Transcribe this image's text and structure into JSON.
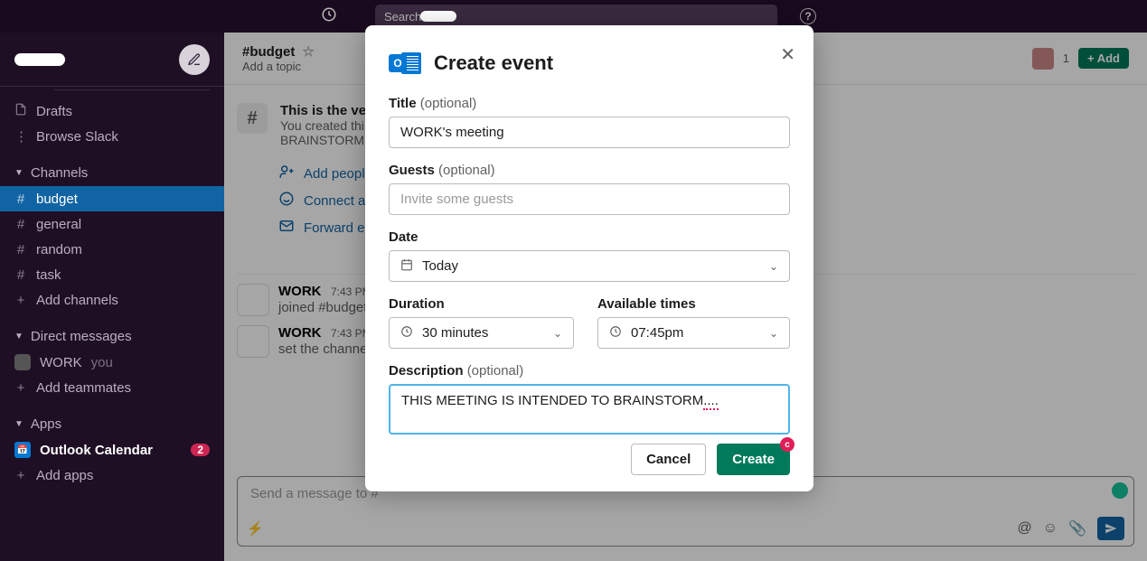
{
  "topbar": {
    "search_label": "Search",
    "help_label": "?"
  },
  "sidebar": {
    "drafts": "Drafts",
    "browse": "Browse Slack",
    "channels_header": "Channels",
    "channels": [
      {
        "name": "budget",
        "active": true
      },
      {
        "name": "general",
        "active": false
      },
      {
        "name": "random",
        "active": false
      },
      {
        "name": "task",
        "active": false
      }
    ],
    "add_channels": "Add channels",
    "dm_header": "Direct messages",
    "dm_user": "WORK",
    "dm_you": "you",
    "add_teammates": "Add teammates",
    "apps_header": "Apps",
    "app_outlook": "Outlook Calendar",
    "app_badge": "2",
    "add_apps": "Add apps"
  },
  "channel": {
    "name": "#budget",
    "topic": "Add a topic",
    "member_count": "1",
    "add_label": "+ Add",
    "intro_first": "This is the very",
    "intro_sub1": "You created thi",
    "intro_sub2": "BRAINSTORM",
    "action_add_people": "Add people",
    "action_connect": "Connect a",
    "action_forward": "Forward e",
    "msg_sender": "WORK",
    "msg_ts": "7:43 PM",
    "msg1_text": "joined #budget",
    "msg2_text": "set the channel",
    "composer_placeholder": "Send a message to #"
  },
  "modal": {
    "title": "Create event",
    "title_label": "Title",
    "title_optional": "(optional)",
    "title_value": "WORK's meeting",
    "guests_label": "Guests",
    "guests_optional": "(optional)",
    "guests_placeholder": "Invite some guests",
    "date_label": "Date",
    "date_value": "Today",
    "duration_label": "Duration",
    "duration_value": "30 minutes",
    "times_label": "Available times",
    "times_value": "07:45pm",
    "description_label": "Description",
    "description_optional": "(optional)",
    "description_value": "THIS MEETING IS INTENDED TO BRAINSTORM",
    "description_spell": "....",
    "cancel": "Cancel",
    "create": "Create"
  }
}
